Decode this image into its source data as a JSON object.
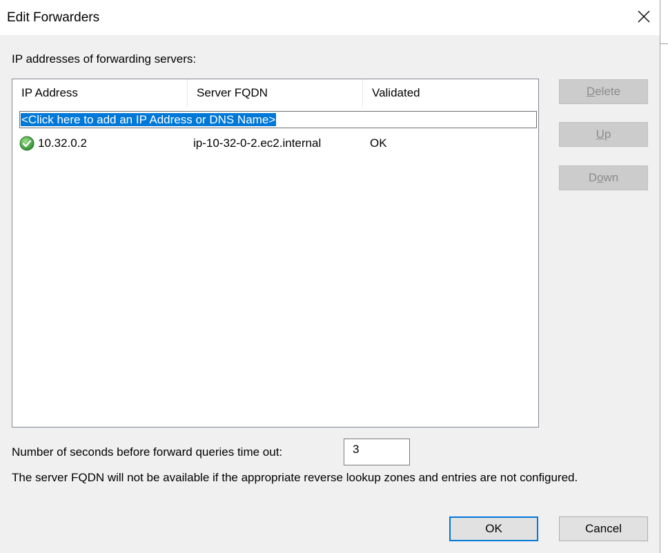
{
  "window": {
    "title": "Edit Forwarders",
    "close_icon": "close-icon"
  },
  "list": {
    "caption": "IP addresses of forwarding servers:",
    "columns": [
      "IP Address",
      "Server FQDN",
      "Validated"
    ],
    "add_prompt": "<Click here to add an IP Address or DNS Name>",
    "rows": [
      {
        "ip": "10.32.0.2",
        "fqdn": "ip-10-32-0-2.ec2.internal",
        "validated": "OK",
        "status_icon": "check-circle-icon",
        "status_color": "#3aa03a"
      }
    ]
  },
  "side_buttons": {
    "delete": {
      "label": "Delete",
      "mnemonic": "D",
      "rest": "elete",
      "enabled": false
    },
    "up": {
      "label": "Up",
      "mnemonic": "U",
      "rest": "p",
      "enabled": false
    },
    "down": {
      "label": "Down",
      "pre": "D",
      "mnemonic": "o",
      "rest": "wn",
      "enabled": false
    }
  },
  "timeout": {
    "label": "Number of seconds before forward queries time out:",
    "value": "3"
  },
  "note": "The server FQDN will not be available if the appropriate reverse lookup zones and entries are not configured.",
  "footer": {
    "ok_label": "OK",
    "cancel_label": "Cancel"
  },
  "colors": {
    "selection": "#0078d7",
    "dialog_bg": "#f0f0f0",
    "accent_border": "#0078d7"
  }
}
